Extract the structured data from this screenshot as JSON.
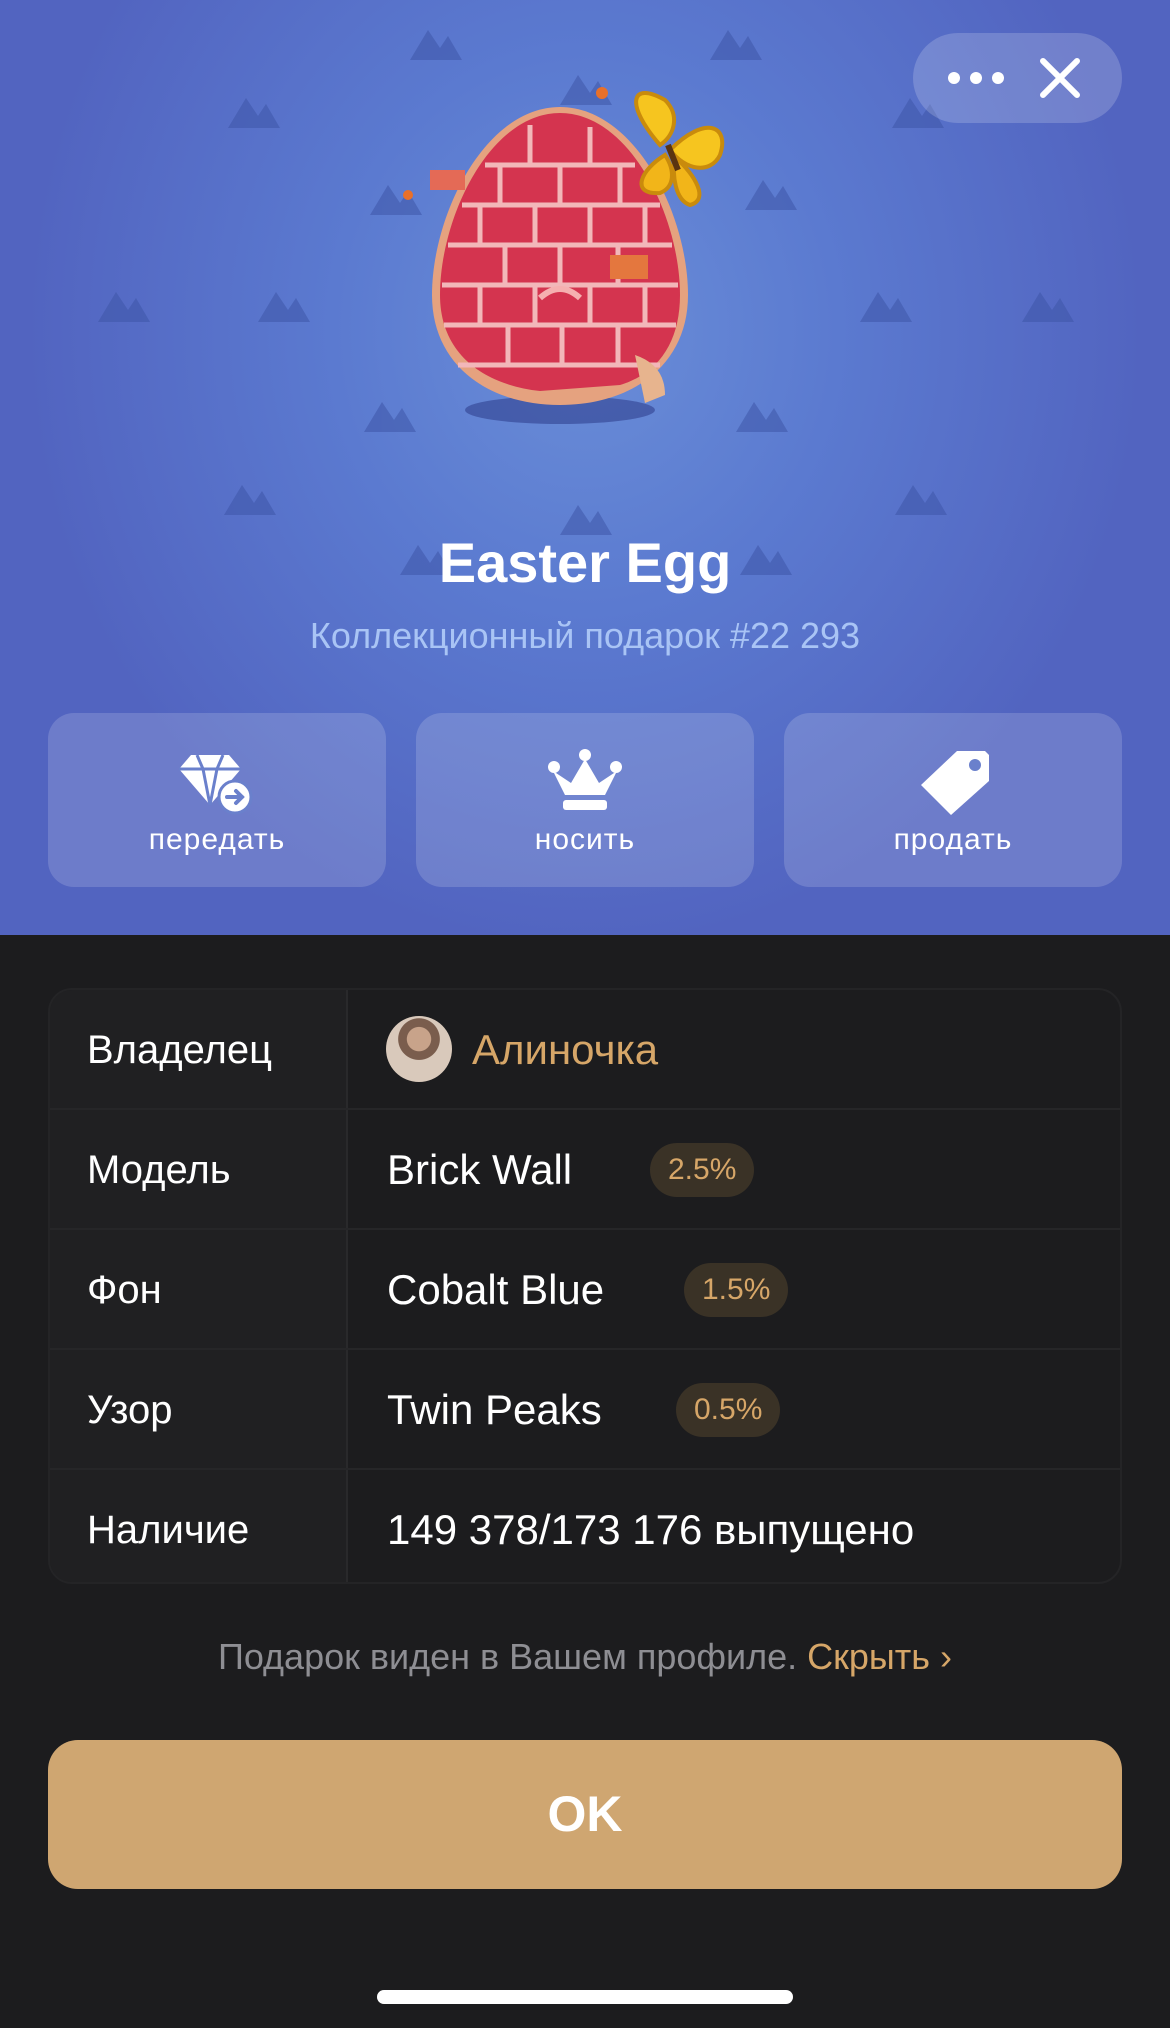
{
  "header": {
    "more_icon": "ellipsis-icon",
    "close_icon": "close-icon"
  },
  "gift": {
    "name": "Easter Egg",
    "subtitle": "Коллекционный подарок #22 293",
    "background_color": "#5b7ad0",
    "pattern_icon": "twin-peaks-icon"
  },
  "actions": [
    {
      "label": "передать",
      "icon": "transfer-gem-icon"
    },
    {
      "label": "носить",
      "icon": "crown-icon"
    },
    {
      "label": "продать",
      "icon": "price-tag-icon"
    }
  ],
  "details": {
    "owner": {
      "label": "Владелец",
      "value": "Алиночка"
    },
    "model": {
      "label": "Модель",
      "value": "Brick Wall",
      "rarity": "2.5%"
    },
    "backdrop": {
      "label": "Фон",
      "value": "Cobalt Blue",
      "rarity": "1.5%"
    },
    "symbol": {
      "label": "Узор",
      "value": "Twin Peaks",
      "rarity": "0.5%"
    },
    "availability": {
      "label": "Наличие",
      "value": "149 378/173 176 выпущено"
    }
  },
  "notice": {
    "text": "Подарок виден в Вашем профиле.",
    "link": "Скрыть",
    "chevron": "›"
  },
  "ok_button": {
    "label": "OK"
  },
  "colors": {
    "accent": "#d6a668",
    "button": "#cfa671",
    "surface": "#1c1c1e"
  }
}
